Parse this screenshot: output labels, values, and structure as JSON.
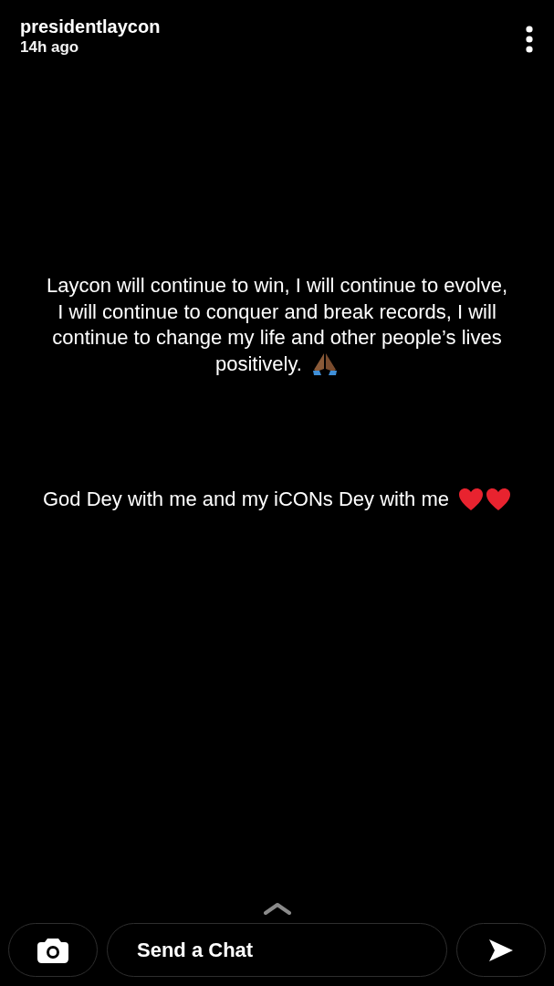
{
  "header": {
    "username": "presidentlaycon",
    "time": "14h ago"
  },
  "paragraphs": [
    {
      "lines": [
        "Laycon will continue to win, I will continue to evolve,",
        "I will continue to conquer and break records, I will",
        "continue to change my life and other people’s lives",
        "positively."
      ],
      "trailing_icons": [
        {
          "kind": "praying-hands"
        }
      ]
    },
    {
      "lines": [
        "God Dey with me and my iCONs Dey with me"
      ],
      "trailing_icons": [
        {
          "kind": "heart"
        },
        {
          "kind": "heart"
        }
      ]
    }
  ],
  "chat_field": {
    "placeholder": "Send a Chat"
  }
}
